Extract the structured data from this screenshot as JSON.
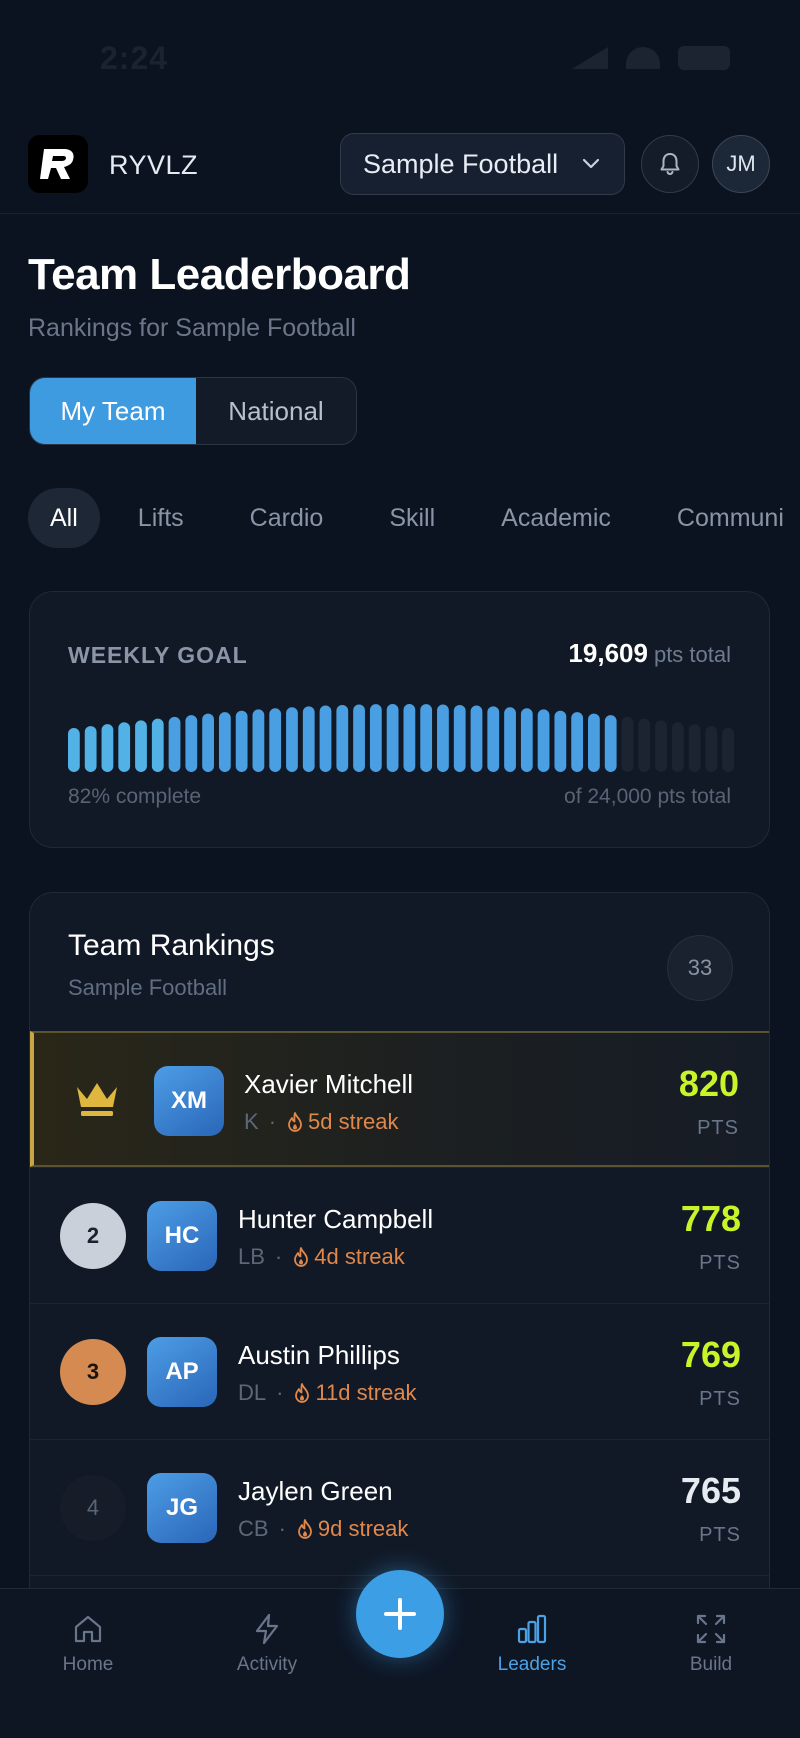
{
  "status_bar": {
    "time": "2:24"
  },
  "header": {
    "brand": "RYVLZ",
    "team_select": "Sample Football",
    "user_initials": "JM"
  },
  "page": {
    "title": "Team Leaderboard",
    "subtitle": "Rankings for Sample Football"
  },
  "segment": {
    "options": [
      "My Team",
      "National"
    ],
    "selected": "My Team"
  },
  "filters": {
    "items": [
      "All",
      "Lifts",
      "Cardio",
      "Skill",
      "Academic",
      "Communi"
    ],
    "selected": "All"
  },
  "weekly_goal": {
    "label": "WEEKLY GOAL",
    "total_value": "19,609",
    "total_unit": "pts total",
    "progress_fraction": 0.82,
    "percent_text": "82% complete",
    "target_text": "of 24,000 pts total",
    "bar_count": 40
  },
  "rankings": {
    "title": "Team Rankings",
    "subtitle": "Sample Football",
    "count": "33",
    "pts_label": "PTS",
    "rows": [
      {
        "rank": "1",
        "initials": "XM",
        "name": "Xavier Mitchell",
        "position": "K",
        "streak": "5d streak",
        "points": "820"
      },
      {
        "rank": "2",
        "initials": "HC",
        "name": "Hunter Campbell",
        "position": "LB",
        "streak": "4d streak",
        "points": "778"
      },
      {
        "rank": "3",
        "initials": "AP",
        "name": "Austin Phillips",
        "position": "DL",
        "streak": "11d streak",
        "points": "769"
      },
      {
        "rank": "4",
        "initials": "JG",
        "name": "Jaylen Green",
        "position": "CB",
        "streak": "9d streak",
        "points": "765"
      }
    ]
  },
  "tabbar": {
    "items": [
      {
        "label": "Home",
        "icon": "home-icon"
      },
      {
        "label": "Activity",
        "icon": "bolt-icon"
      },
      {
        "label": "Leaders",
        "icon": "bar-chart-icon",
        "active": true
      },
      {
        "label": "Build",
        "icon": "expand-icon"
      }
    ]
  },
  "colors": {
    "background": "#0c1320",
    "accent": "#3e9be0",
    "points_highlight": "#c8f52a",
    "gold": "#c9a544",
    "silver": "#c9d0da",
    "bronze": "#d48a50",
    "streak": "#e0874a"
  }
}
